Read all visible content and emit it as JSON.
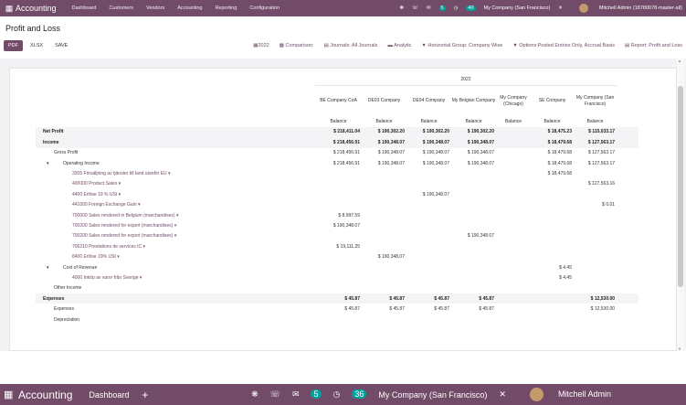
{
  "topbar": {
    "app_name": "Accounting",
    "menus": [
      "Dashboard",
      "Customers",
      "Vendors",
      "Accounting",
      "Reporting",
      "Configuration"
    ],
    "bug_icon": "bug-icon",
    "phone_icon": "phone-icon",
    "chat_count": "5",
    "activity_count": "40",
    "company": "My Company (San Francisco)",
    "user": "Mitchell Admin (18780078-master-all)"
  },
  "page": {
    "title": "Profit and Loss"
  },
  "buttons": {
    "pdf": "PDF",
    "xlsx": "XLSX",
    "save": "SAVE"
  },
  "filters": {
    "date": "2022",
    "comparison": "Comparison:",
    "journals": "Journals: All Journals",
    "analytic": "Analytic",
    "horizontal": "Horizontal Group: Company Wise",
    "options": "Options:Posted Entries Only, Accrual Basis",
    "report": "Report: Profit and Loss"
  },
  "report": {
    "period": "2022",
    "columns": [
      "BE Company CoA",
      "DE03 Company",
      "DE04 Company",
      "My Belgian Company",
      "My Company (Chicago)",
      "SE Company",
      "My Company (San Francisco)"
    ],
    "subheader": [
      "Balance",
      "Balance",
      "Balance",
      "Balance",
      "Balance",
      "Balance",
      "Balance"
    ],
    "rows": [
      {
        "label": "Net Profit",
        "level": 0,
        "values": [
          "$ 218,411.04",
          "$ 190,302.20",
          "$ 190,302.20",
          "$ 190,302.20",
          "",
          "$ 18,475.23",
          "$ 115,033.17"
        ]
      },
      {
        "label": "Income",
        "level": 0,
        "values": [
          "$ 218,456.91",
          "$ 190,348.07",
          "$ 190,348.07",
          "$ 190,348.07",
          "",
          "$ 18,479.68",
          "$ 127,563.17"
        ]
      },
      {
        "label": "Gross Profit",
        "level": 1,
        "values": [
          "$ 218,456.91",
          "$ 190,348.07",
          "$ 190,348.07",
          "$ 190,348.07",
          "",
          "$ 18,479.68",
          "$ 127,563.17"
        ]
      },
      {
        "label": "Operating Income",
        "level": 2,
        "values": [
          "$ 218,456.91",
          "$ 190,348.07",
          "$ 190,348.07",
          "$ 190,348.07",
          "",
          "$ 18,479.68",
          "$ 127,563.17"
        ]
      },
      {
        "label": "3305 Försäljning av tjänster till land utanför EU ▾",
        "level": 3,
        "values": [
          "",
          "",
          "",
          "",
          "",
          "$ 18,479.68",
          ""
        ]
      },
      {
        "label": "400000 Product Sales ▾",
        "level": 3,
        "values": [
          "",
          "",
          "",
          "",
          "",
          "",
          "$ 127,563.16"
        ]
      },
      {
        "label": "4400 Erlöse 19 % USt ▾",
        "level": 3,
        "values": [
          "",
          "",
          "$ 190,348.07",
          "",
          "",
          "",
          ""
        ]
      },
      {
        "label": "441000 Foreign Exchange Gain ▾",
        "level": 3,
        "values": [
          "",
          "",
          "",
          "",
          "",
          "",
          "$ 0.01"
        ]
      },
      {
        "label": "700000 Sales rendered in Belgium (marchandises) ▾",
        "level": 3,
        "values": [
          "$ 8,997.59",
          "",
          "",
          "",
          "",
          "",
          ""
        ]
      },
      {
        "label": "700200 Sales rendered for export (marchandises) ▾",
        "level": 3,
        "values": [
          "$ 190,348.07",
          "",
          "",
          "",
          "",
          "",
          ""
        ]
      },
      {
        "label": "700200 Sales rendered for export (marchandises) ▾",
        "level": 3,
        "values": [
          "",
          "",
          "",
          "$ 190,348.07",
          "",
          "",
          ""
        ]
      },
      {
        "label": "706210 Prestations de services IC ▾",
        "level": 3,
        "values": [
          "$ 19,111.25",
          "",
          "",
          "",
          "",
          "",
          ""
        ]
      },
      {
        "label": "8400 Erlöse 19% USt ▾",
        "level": 3,
        "values": [
          "",
          "$ 190,348.07",
          "",
          "",
          "",
          "",
          ""
        ]
      },
      {
        "label": "Cost of Revenue",
        "level": 2,
        "values": [
          "",
          "",
          "",
          "",
          "",
          "$ 4.45",
          ""
        ]
      },
      {
        "label": "4000 Inköp av varor från Sverige ▾",
        "level": 3,
        "values": [
          "",
          "",
          "",
          "",
          "",
          "$ 4.45",
          ""
        ]
      },
      {
        "label": "Other Income",
        "level": 1,
        "values": [
          "",
          "",
          "",
          "",
          "",
          "",
          ""
        ]
      },
      {
        "label": "Expenses",
        "level": 0,
        "values": [
          "$ 45.87",
          "$ 45.87",
          "$ 45.87",
          "$ 45.87",
          "",
          "",
          "$ 12,530.00"
        ]
      },
      {
        "label": "Expenses",
        "level": 1,
        "values": [
          "$ 45.87",
          "$ 45.87",
          "$ 45.87",
          "$ 45.87",
          "",
          "",
          "$ 12,530.00"
        ]
      },
      {
        "label": "Depreciation",
        "level": 1,
        "values": [
          "",
          "",
          "",
          "",
          "",
          "",
          ""
        ]
      }
    ]
  },
  "bottombar": {
    "app_name": "Accounting",
    "menu": "Dashboard",
    "plus": "+",
    "chat_count": "5",
    "activity_count": "36",
    "company": "My Company (San Francisco)",
    "user": "Mitchell Admin"
  },
  "colors": {
    "brand": "#714B67",
    "accent": "#00A09D"
  }
}
